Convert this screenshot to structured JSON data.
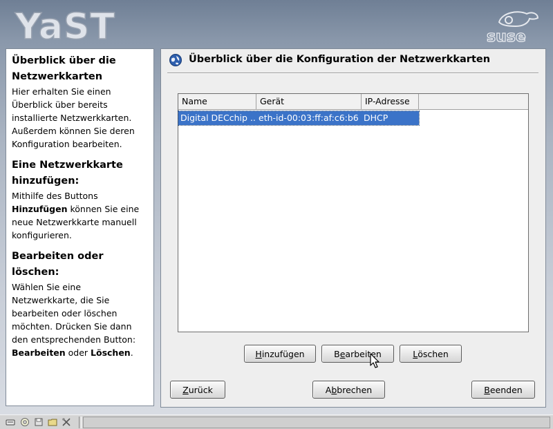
{
  "branding": {
    "app_logo": "YaST",
    "vendor_logo": "SuSE"
  },
  "help": {
    "section1_title": "Überblick über die Netzwerkkarten",
    "section1_text": "Hier erhalten Sie einen Überblick über bereits installierte Netzwerkkarten. Außerdem können Sie deren Konfiguration bearbeiten.",
    "section2_title": "Eine Netzwerkkarte hinzufügen:",
    "section2_text_a": "Mithilfe des Buttons ",
    "section2_text_bold": "Hinzufügen",
    "section2_text_b": " können Sie eine neue Netzwerkkarte manuell konfigurieren.",
    "section3_title": "Bearbeiten oder löschen:",
    "section3_text": "Wählen Sie eine Netzwerkkarte, die Sie bearbeiten oder löschen möchten. Drücken Sie dann den entsprechenden Button: ",
    "section3_bold1": "Bearbeiten",
    "section3_mid": " oder ",
    "section3_bold2": "Löschen",
    "section3_end": "."
  },
  "main": {
    "title": "Überblick über die Konfiguration der Netzwerkkarten",
    "title_icon": "network-globe-icon",
    "table": {
      "columns": [
        "Name",
        "Gerät",
        "IP-Adresse"
      ],
      "rows": [
        {
          "name": "Digital DECchip ...",
          "device": "eth-id-00:03:ff:af:c6:b6",
          "ip": "DHCP",
          "selected": true
        }
      ]
    },
    "actions": {
      "add": {
        "mnemonic": "H",
        "rest": "inzufügen"
      },
      "edit": {
        "pre": "B",
        "mnemonic": "e",
        "rest": "arbeiten"
      },
      "delete": {
        "mnemonic": "L",
        "rest": "öschen"
      }
    },
    "nav": {
      "back": {
        "mnemonic": "Z",
        "rest": "urück"
      },
      "cancel": {
        "pre": "A",
        "mnemonic": "b",
        "rest": "brechen"
      },
      "finish": {
        "mnemonic": "B",
        "rest": "eenden"
      }
    }
  },
  "colors": {
    "selection": "#3b73c8",
    "panel_bg": "#eeeeee",
    "desktop_top": "#6f7f95"
  },
  "taskbar": {
    "icons": [
      "keyboard-icon",
      "lifebuoy-icon",
      "disk-icon",
      "folder-icon",
      "tools-icon"
    ]
  }
}
